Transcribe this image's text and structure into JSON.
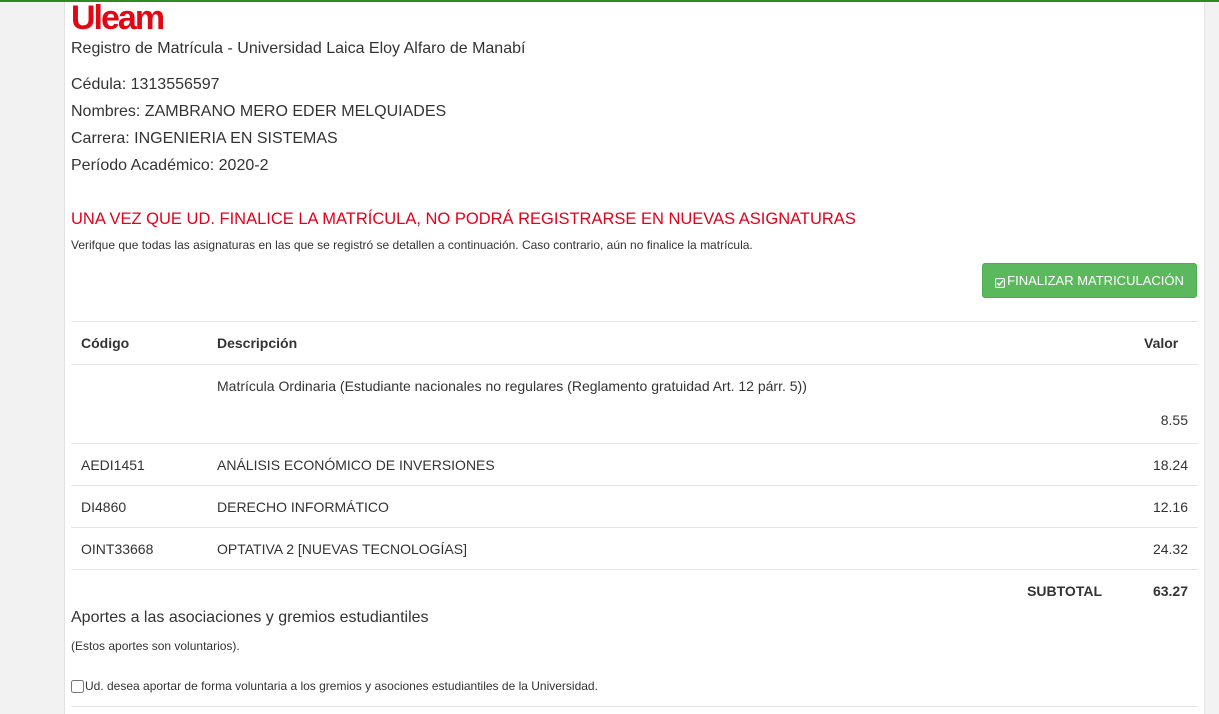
{
  "brand": {
    "logo_text": "Uleam",
    "logo_color": "#e30613"
  },
  "header": {
    "subtitle": "Registro de Matrícula - Universidad Laica Eloy Alfaro de Manabí"
  },
  "student": {
    "cedula": "Cédula: 1313556597",
    "nombres": "Nombres: ZAMBRANO MERO EDER MELQUIADES",
    "carrera": "Carrera: INGENIERIA EN SISTEMAS",
    "periodo": "Período Académico: 2020-2"
  },
  "warning": {
    "title": "UNA VEZ QUE UD. FINALICE LA MATRÍCULA, NO PODRÁ REGISTRARSE EN NUEVAS ASIGNATURAS",
    "note": "Verifque que todas las asignaturas en las que se registró se detallen a continuación. Caso contrario, aún no finalice la matrícula."
  },
  "actions": {
    "finalize_label": "FINALIZAR MATRICULACIÓN",
    "finalize_icon": "check-square-icon",
    "finalize_color": "#5cb85c"
  },
  "table": {
    "headers": {
      "codigo": "Código",
      "descripcion": "Descripción",
      "valor": "Valor"
    },
    "rows": [
      {
        "codigo": "",
        "descripcion": "Matrícula Ordinaria (Estudiante nacionales no regulares (Reglamento gratuidad Art. 12 párr. 5))",
        "valor": "8.55"
      },
      {
        "codigo": "AEDI1451",
        "descripcion": "ANÁLISIS ECONÓMICO DE INVERSIONES",
        "valor": "18.24"
      },
      {
        "codigo": "DI4860",
        "descripcion": "DERECHO INFORMÁTICO",
        "valor": "12.16"
      },
      {
        "codigo": "OINT33668",
        "descripcion": "OPTATIVA 2 [NUEVAS TECNOLOGÍAS]",
        "valor": "24.32"
      }
    ],
    "subtotal_label": "SUBTOTAL",
    "subtotal_value": "63.27"
  },
  "aportes": {
    "title": "Aportes a las asociaciones y gremios estudiantiles",
    "note": "(Estos aportes son voluntarios).",
    "checkbox_label": "Ud. desea aportar de forma voluntaria a los gremios y asociones estudiantiles de la Universidad.",
    "checked": false
  }
}
